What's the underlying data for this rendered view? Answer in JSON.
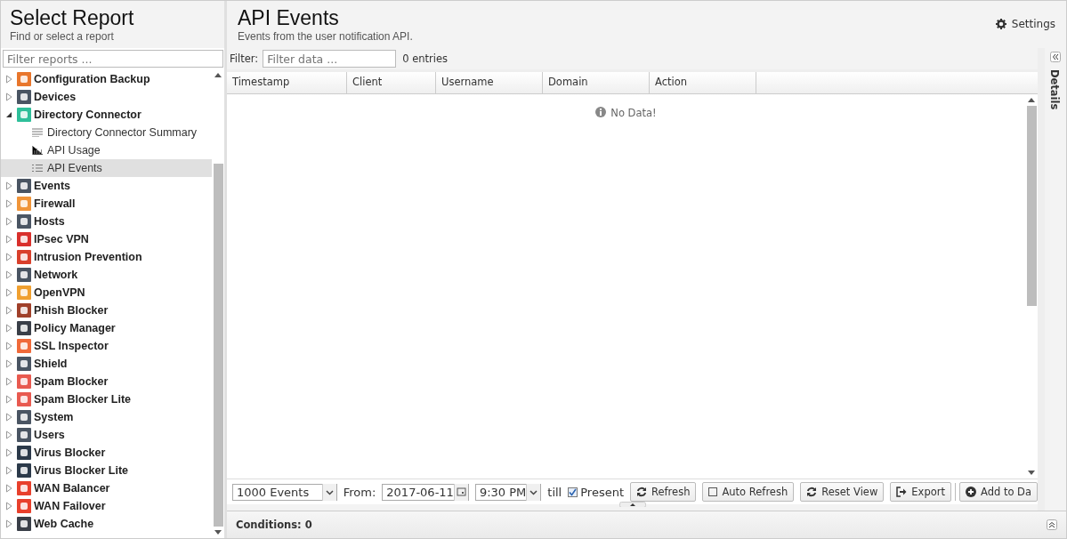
{
  "sidebar": {
    "title": "Select Report",
    "subtitle": "Find or select a report",
    "filter": {
      "placeholder": "Filter reports ..."
    },
    "items": [
      {
        "label": "Configuration Backup",
        "color": "#e8762c",
        "expanded": false
      },
      {
        "label": "Devices",
        "color": "#4a5563",
        "expanded": false
      },
      {
        "label": "Directory Connector",
        "color": "#2fbf9a",
        "expanded": true,
        "children": [
          {
            "label": "Directory Connector Summary",
            "kind": "text",
            "selected": false
          },
          {
            "label": "API Usage",
            "kind": "chart",
            "selected": false
          },
          {
            "label": "API Events",
            "kind": "events",
            "selected": true
          }
        ]
      },
      {
        "label": "Events",
        "color": "#4a5563",
        "expanded": false
      },
      {
        "label": "Firewall",
        "color": "#f0953a",
        "expanded": false
      },
      {
        "label": "Hosts",
        "color": "#4a5563",
        "expanded": false
      },
      {
        "label": "IPsec VPN",
        "color": "#d9302c",
        "expanded": false
      },
      {
        "label": "Intrusion Prevention",
        "color": "#d9402c",
        "expanded": false
      },
      {
        "label": "Network",
        "color": "#4a5563",
        "expanded": false
      },
      {
        "label": "OpenVPN",
        "color": "#f0a030",
        "expanded": false
      },
      {
        "label": "Phish Blocker",
        "color": "#a0402a",
        "expanded": false
      },
      {
        "label": "Policy Manager",
        "color": "#3a3f48",
        "expanded": false
      },
      {
        "label": "SSL Inspector",
        "color": "#f06a3a",
        "expanded": false
      },
      {
        "label": "Shield",
        "color": "#4a5563",
        "expanded": false
      },
      {
        "label": "Spam Blocker",
        "color": "#e85a50",
        "expanded": false
      },
      {
        "label": "Spam Blocker Lite",
        "color": "#e85a50",
        "expanded": false
      },
      {
        "label": "System",
        "color": "#4a5563",
        "expanded": false
      },
      {
        "label": "Users",
        "color": "#4a5563",
        "expanded": false
      },
      {
        "label": "Virus Blocker",
        "color": "#2c3a4a",
        "expanded": false
      },
      {
        "label": "Virus Blocker Lite",
        "color": "#2c3a4a",
        "expanded": false
      },
      {
        "label": "WAN Balancer",
        "color": "#e8402c",
        "expanded": false
      },
      {
        "label": "WAN Failover",
        "color": "#e8402c",
        "expanded": false
      },
      {
        "label": "Web Cache",
        "color": "#3a3f48",
        "expanded": false
      }
    ]
  },
  "report": {
    "title": "API Events",
    "subtitle": "Events from the user notification API.",
    "settings": "Settings",
    "filter_label": "Filter:",
    "filter": {
      "placeholder": "Filter data ..."
    },
    "entries": "0 entries",
    "columns": [
      "Timestamp",
      "Client",
      "Username",
      "Domain",
      "Action"
    ],
    "empty_message": "No Data!",
    "toolbar": {
      "limit": "1000 Events",
      "from_label": "From:",
      "date": "2017-06-11",
      "time": "9:30 PM",
      "till_label": "till",
      "present": {
        "label": "Present",
        "checked": true
      },
      "auto_refresh": {
        "label": "Auto Refresh",
        "checked": false
      },
      "buttons": [
        {
          "label": "Refresh",
          "kind": "refresh"
        },
        {
          "label": "Reset View",
          "kind": "refresh"
        },
        {
          "label": "Export",
          "kind": "export"
        },
        {
          "label": "Add to Da",
          "kind": "add"
        }
      ]
    },
    "conditions": "Conditions: 0",
    "details": "Details"
  }
}
